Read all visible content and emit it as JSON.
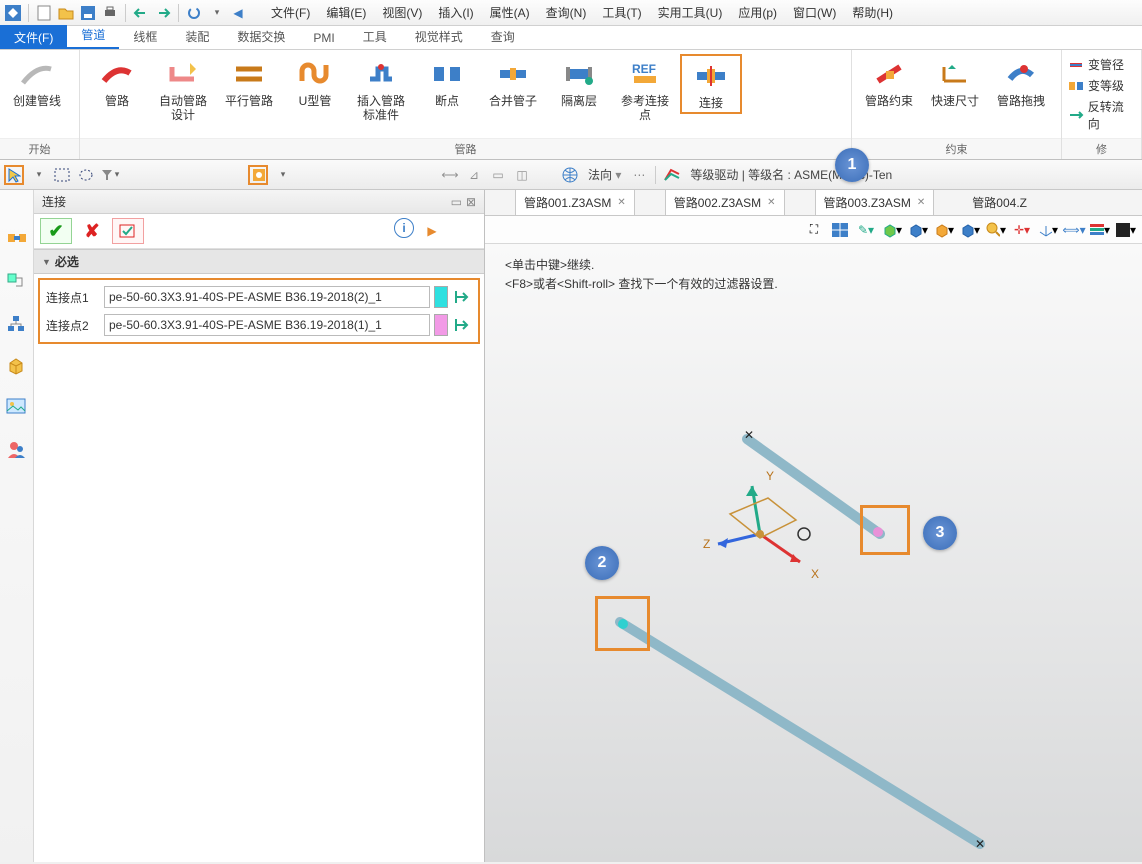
{
  "menus": [
    "文件(F)",
    "编辑(E)",
    "视图(V)",
    "插入(I)",
    "属性(A)",
    "查询(N)",
    "工具(T)",
    "实用工具(U)",
    "应用(p)",
    "窗口(W)",
    "帮助(H)"
  ],
  "file_tab": "文件(F)",
  "ribbon_tabs": [
    "管道",
    "线框",
    "装配",
    "数据交换",
    "PMI",
    "工具",
    "视觉样式",
    "查询"
  ],
  "ribbon_active": 0,
  "group_start": {
    "label": "开始",
    "items": [
      {
        "label": "创建管线"
      }
    ]
  },
  "group_route": {
    "label": "管路",
    "items": [
      {
        "label": "管路"
      },
      {
        "label": "自动管路设计"
      },
      {
        "label": "平行管路"
      },
      {
        "label": "U型管"
      },
      {
        "label": "插入管路标准件"
      },
      {
        "label": "断点"
      },
      {
        "label": "合并管子"
      },
      {
        "label": "隔离层"
      },
      {
        "label": "参考连接点"
      },
      {
        "label": "连接",
        "hl": true
      }
    ]
  },
  "group_constraint": {
    "label": "约束",
    "items": [
      {
        "label": "管路约束"
      },
      {
        "label": "快速尺寸"
      },
      {
        "label": "管路拖拽"
      }
    ]
  },
  "group_props": {
    "label": "修",
    "items": [
      "变管径",
      "变等级",
      "反转流向"
    ]
  },
  "toolbar2_combo": "法向",
  "toolbar2_status": "等级驱动 | 等级名 : ASME(Metric)-Ten",
  "panel_title": "连接",
  "panel_section": "必选",
  "rows": [
    {
      "label": "连接点1",
      "value": "pe-50-60.3X3.91-40S-PE-ASME B36.19-2018(2)_1",
      "swatch": "#2fe0e0"
    },
    {
      "label": "连接点2",
      "value": "pe-50-60.3X3.91-40S-PE-ASME B36.19-2018(1)_1",
      "swatch": "#f29ae6"
    }
  ],
  "doc_tabs": [
    "管路001.Z3ASM",
    "管路002.Z3ASM",
    "管路003.Z3ASM",
    "管路004.Z"
  ],
  "help_lines": [
    "<单击中键>继续.",
    "<F8>或者<Shift-roll> 查找下一个有效的过滤器设置."
  ],
  "axis": {
    "x": "X",
    "y": "Y",
    "z": "Z"
  },
  "callouts": {
    "c1": "1",
    "c2": "2",
    "c3": "3"
  }
}
